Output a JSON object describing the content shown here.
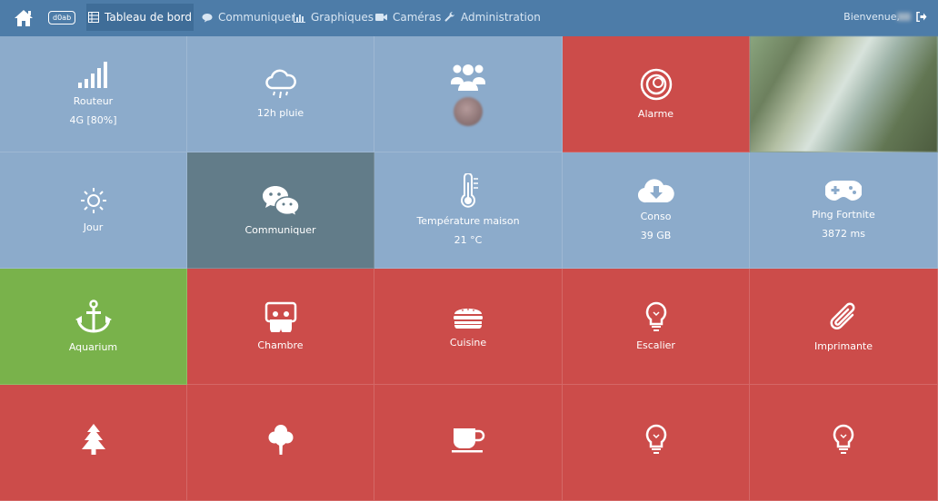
{
  "nav": {
    "badge": "d0ab",
    "items": [
      {
        "label": "Tableau de bord",
        "active": true
      },
      {
        "label": "Communiquer"
      },
      {
        "label": "Graphiques"
      },
      {
        "label": "Caméras"
      },
      {
        "label": "Administration"
      }
    ],
    "welcome": "Bienvenue,",
    "logout_icon": "sign-out-icon"
  },
  "tiles": [
    {
      "label": "Routeur",
      "value": "4G [80%]",
      "icon": "signal-bars-icon",
      "color": "#8cabcb"
    },
    {
      "label": "12h pluie",
      "icon": "cloud-rain-icon",
      "color": "#8cabcb"
    },
    {
      "label": "",
      "icon": "group-icon",
      "color": "#8cabcb"
    },
    {
      "label": "Alarme",
      "icon": "alarm-icon",
      "color": "#cc4c4a"
    },
    {
      "label": "",
      "icon": "camera-photo",
      "color": "#8aa57e"
    },
    {
      "label": "Jour",
      "icon": "sun-icon",
      "color": "#8cabcb"
    },
    {
      "label": "Communiquer",
      "icon": "wechat-icon",
      "color": "#627c89"
    },
    {
      "label": "Température maison",
      "value": "21 °C",
      "icon": "thermometer-icon",
      "color": "#8cabcb"
    },
    {
      "label": "Conso",
      "value": "39 GB",
      "icon": "cloud-download-icon",
      "color": "#8cabcb"
    },
    {
      "label": "Ping Fortnite",
      "value": "3872 ms",
      "icon": "gamepad-icon",
      "color": "#8cabcb"
    },
    {
      "label": "Aquarium",
      "icon": "anchor-icon",
      "color": "#79b24b"
    },
    {
      "label": "Chambre",
      "icon": "sleep-icon",
      "color": "#cc4c4a"
    },
    {
      "label": "Cuisine",
      "icon": "burger-icon",
      "color": "#cc4c4a"
    },
    {
      "label": "Escalier",
      "icon": "lightbulb-icon",
      "color": "#cc4c4a"
    },
    {
      "label": "Imprimante",
      "icon": "paperclip-icon",
      "color": "#cc4c4a"
    },
    {
      "label": "",
      "icon": "tree-icon",
      "color": "#cc4c4a"
    },
    {
      "label": "",
      "icon": "tree-round-icon",
      "color": "#cc4c4a"
    },
    {
      "label": "",
      "icon": "coffee-icon",
      "color": "#cc4c4a"
    },
    {
      "label": "",
      "icon": "lightbulb-icon",
      "color": "#cc4c4a"
    },
    {
      "label": "",
      "icon": "lightbulb-icon",
      "color": "#cc4c4a"
    }
  ]
}
